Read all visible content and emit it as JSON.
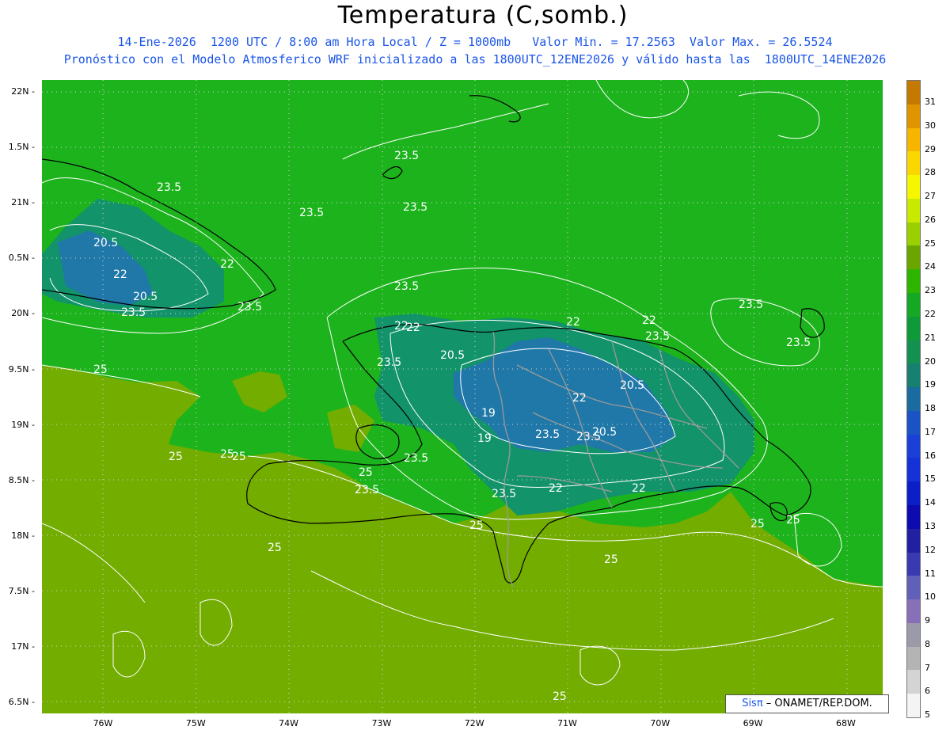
{
  "title": "Temperatura (C,somb.)",
  "subtitle_line1": "14-Ene-2026  1200 UTC / 8:00 am Hora Local / Z = 1000mb   Valor Min. = 17.2563  Valor Max. = 26.5524",
  "subtitle_line2": "Pronóstico con el Modelo Atmosferico WRF inicializado a las 1800UTC_12ENE2026 y válido hasta las  1800UTC_14ENE2026",
  "lat_labels": [
    "22N",
    "1.5N",
    "21N",
    "0.5N",
    "20N",
    "9.5N",
    "19N",
    "8.5N",
    "18N",
    "7.5N",
    "17N",
    "6.5N"
  ],
  "lon_labels": [
    "76W",
    "75W",
    "74W",
    "73W",
    "72W",
    "71W",
    "70W",
    "69W",
    "68W"
  ],
  "contour_labels": [
    "23.5",
    "23.5",
    "23.5",
    "23.5",
    "20.5",
    "22",
    "22",
    "20.5",
    "23.5",
    "23.5",
    "22",
    "23.5",
    "22",
    "23.5",
    "20.5",
    "22",
    "23.5",
    "19",
    "20.5",
    "22",
    "20.5",
    "22",
    "19",
    "23.5",
    "23.5",
    "23.5",
    "23.5",
    "22",
    "22",
    "23.5",
    "25",
    "25",
    "25",
    "25",
    "25",
    "23.5",
    "25",
    "23.5",
    "25",
    "25",
    "25",
    "25",
    "25"
  ],
  "colorbar": {
    "levels": [
      "31",
      "30",
      "29",
      "28",
      "27",
      "26",
      "25",
      "24",
      "23",
      "22",
      "21",
      "20",
      "19",
      "18",
      "17",
      "16",
      "15",
      "14",
      "13",
      "12",
      "11",
      "10",
      "9",
      "8",
      "7",
      "6",
      "5"
    ],
    "colors": [
      "#c47a00",
      "#e09400",
      "#f7b500",
      "#fbd700",
      "#f6f600",
      "#c8ea00",
      "#9ad000",
      "#6ba600",
      "#2eb500",
      "#14a824",
      "#0f9a3a",
      "#129150",
      "#178070",
      "#1a6ba0",
      "#1a54c4",
      "#1a40d8",
      "#1532d8",
      "#0b1ec8",
      "#0d0ab0",
      "#2020a0",
      "#3a3ab0",
      "#6060b8",
      "#8870b8",
      "#9a9aa8",
      "#b4b4b4",
      "#d4d4d4",
      "#f4f4f4"
    ]
  },
  "map_colors": {
    "ocean_green": "#1db31d",
    "warm_green": "#72ad00",
    "cool_teal": "#12936a",
    "cold_blue": "#1f78a8",
    "coast": "#000000",
    "border": "#9a9a9a"
  },
  "credit": {
    "sis": "Sisπ",
    "rest": " – ONAMET/REP.DOM."
  }
}
